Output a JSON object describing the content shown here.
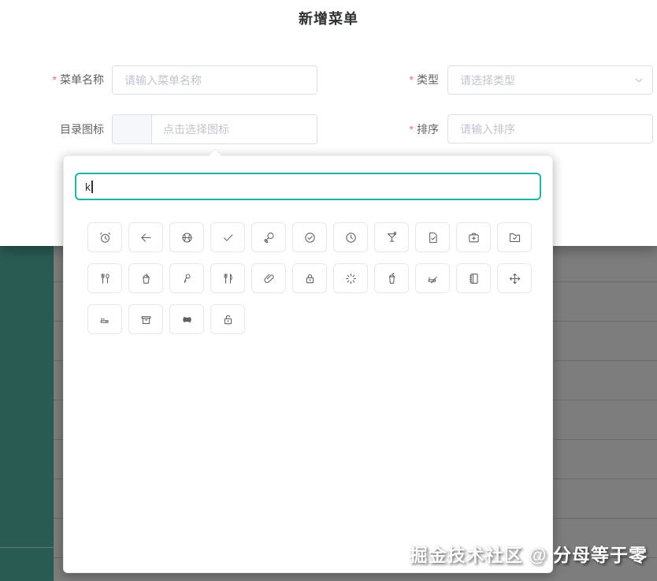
{
  "dialog": {
    "title": "新增菜单",
    "required_marker": "*",
    "form": {
      "menu_name": {
        "label": "菜单名称",
        "required": true,
        "placeholder": "请输入菜单名称"
      },
      "type": {
        "label": "类型",
        "required": true,
        "placeholder": "请选择类型"
      },
      "dir_icon": {
        "label": "目录图标",
        "required": false,
        "placeholder": "点击选择图标"
      },
      "sort": {
        "label": "排序",
        "required": true,
        "placeholder": "请输入排序"
      }
    }
  },
  "icon_picker": {
    "search_value": "k",
    "icons": [
      "alarm-clock",
      "back",
      "basketball",
      "check",
      "chicken",
      "circle-check",
      "clock",
      "cocktail",
      "document-checked",
      "first-aid-kit",
      "folder-checked",
      "fork-spoon",
      "ice-drink",
      "key",
      "knife-fork",
      "link",
      "lock",
      "magic-stick",
      "milk-tea",
      "no-smoking",
      "notebook",
      "rank",
      "smoking",
      "takeaway-box",
      "tickets",
      "unlock"
    ]
  },
  "watermark": {
    "text": "掘金技术社区 @ 分母等于零"
  },
  "colors": {
    "accent_teal_border": "#1db2aa",
    "sidebar_teal": "#2a5b52",
    "dim_gray": "#7d7d7d",
    "required_red": "#f56c6c",
    "placeholder": "#c0c4cc",
    "label": "#606266",
    "title": "#303133"
  }
}
